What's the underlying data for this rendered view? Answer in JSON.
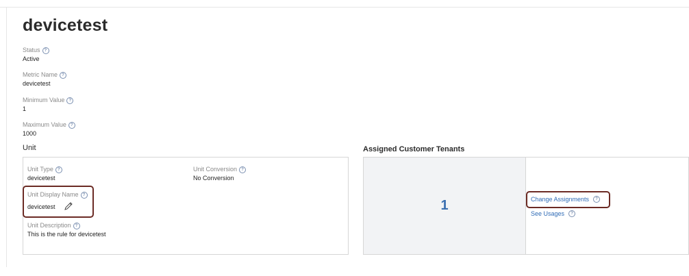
{
  "title": "devicetest",
  "fields": {
    "status": {
      "label": "Status",
      "value": "Active"
    },
    "metric_name": {
      "label": "Metric Name",
      "value": "devicetest"
    },
    "minimum_value": {
      "label": "Minimum Value",
      "value": "1"
    },
    "maximum_value": {
      "label": "Maximum Value",
      "value": "1000"
    }
  },
  "unit": {
    "heading": "Unit",
    "unit_type": {
      "label": "Unit Type",
      "value": "devicetest"
    },
    "unit_conversion": {
      "label": "Unit Conversion",
      "value": "No Conversion"
    },
    "unit_display_name": {
      "label": "Unit Display Name",
      "value": "devicetest"
    },
    "unit_description": {
      "label": "Unit Description",
      "value": "This is the rule for devicetest"
    }
  },
  "tenants": {
    "heading": "Assigned Customer Tenants",
    "count": "1",
    "change_assignments": "Change Assignments",
    "see_usages": "See Usages"
  },
  "icons": {
    "help": "help-circle-icon",
    "edit": "pencil-icon"
  },
  "colors": {
    "link": "#2f6bb6",
    "highlight": "#6b2a24",
    "count": "#3b6fb0"
  }
}
